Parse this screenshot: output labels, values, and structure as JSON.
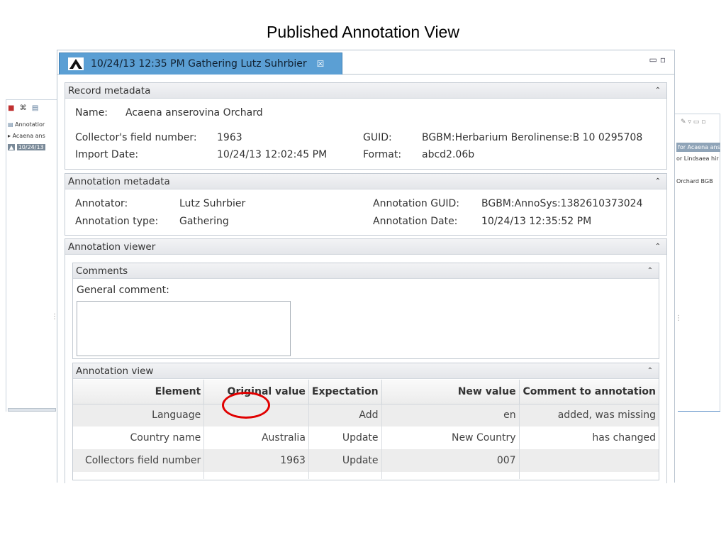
{
  "slide_title": "Published Annotation View",
  "background_left": {
    "toolbar_icons": [
      "stop-icon",
      "binoculars-icon",
      "document-icon"
    ],
    "items": [
      "Annotatior",
      "Acaena ans",
      "10/24/13"
    ]
  },
  "background_right": {
    "toolbar": "✎ ▿ ▭ ▫",
    "lines": [
      "for Acaena ans",
      "or Lindsaea hir",
      "Orchard  BGB"
    ]
  },
  "editor_tab": {
    "title": "10/24/13 12:35 PM Gathering Lutz Suhrbier",
    "close": "☒",
    "window_controls": "▭ ▫"
  },
  "record_metadata": {
    "header": "Record metadata",
    "collapse": "⌃",
    "name_label": "Name:",
    "name_value": "Acaena anserovina Orchard",
    "collector_label": "Collector's field number:",
    "collector_value": "1963",
    "import_label": "Import Date:",
    "import_value": "10/24/13 12:02:45 PM",
    "guid_label": "GUID:",
    "guid_value": "BGBM:Herbarium Berolinense:B 10 0295708",
    "format_label": "Format:",
    "format_value": "abcd2.06b"
  },
  "annotation_metadata": {
    "header": "Annotation metadata",
    "collapse": "⌃",
    "annotator_label": "Annotator:",
    "annotator_value": "Lutz Suhrbier",
    "type_label": "Annotation type:",
    "type_value": "Gathering",
    "guid_label": "Annotation GUID:",
    "guid_value": "BGBM:AnnoSys:1382610373024",
    "date_label": "Annotation Date:",
    "date_value": "10/24/13 12:35:52 PM"
  },
  "annotation_viewer": {
    "header": "Annotation viewer",
    "collapse": "⌃",
    "comments": {
      "header": "Comments",
      "collapse": "⌃",
      "general_label": "General comment:",
      "general_value": ""
    },
    "view": {
      "header": "Annotation view",
      "collapse": "⌃",
      "columns": [
        "Element",
        "Original value",
        "Expectation",
        "New value",
        "Comment to annotation"
      ],
      "rows": [
        [
          "Language",
          "",
          "Add",
          "en",
          "added, was missing"
        ],
        [
          "Country name",
          "Australia",
          "Update",
          "New Country",
          "has changed"
        ],
        [
          "Collectors field number",
          "1963",
          "Update",
          "007",
          ""
        ]
      ]
    }
  },
  "colors": {
    "tab_active": "#5b9fd4",
    "highlight_ellipse": "#e00000"
  }
}
